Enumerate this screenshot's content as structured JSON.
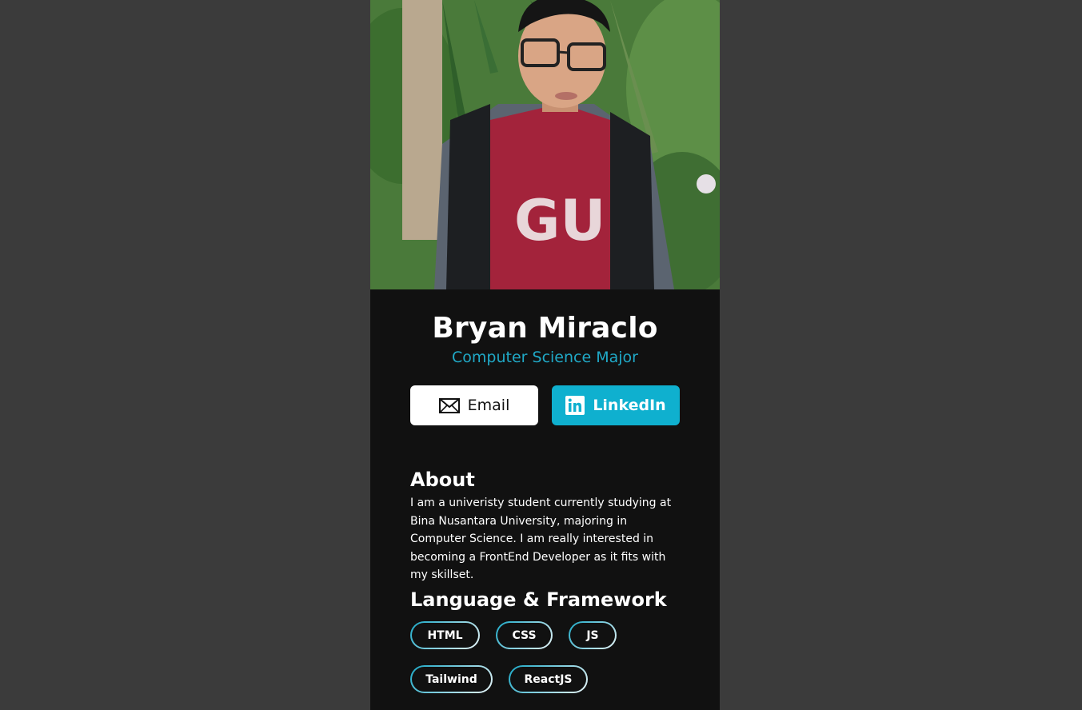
{
  "profile": {
    "name": "Bryan Miraclo",
    "role": "Computer Science Major"
  },
  "buttons": {
    "email_label": "Email",
    "linkedin_label": "LinkedIn"
  },
  "about": {
    "title": "About",
    "text": "I am a univeristy student currently studying at Bina Nusantara University, majoring in Computer Science. I am really interested in becoming a FrontEnd Developer as it fits with my skillset."
  },
  "skills": {
    "title": "Language & Framework",
    "tags": [
      "HTML",
      "CSS",
      "JS",
      "Tailwind",
      "ReactJS"
    ]
  },
  "colors": {
    "page_bg": "#3b3b3b",
    "card_bg": "#111111",
    "accent": "#0fb0cf",
    "role_text": "#20a9c7"
  },
  "icons": {
    "email": "envelope-icon",
    "linkedin": "linkedin-icon"
  }
}
